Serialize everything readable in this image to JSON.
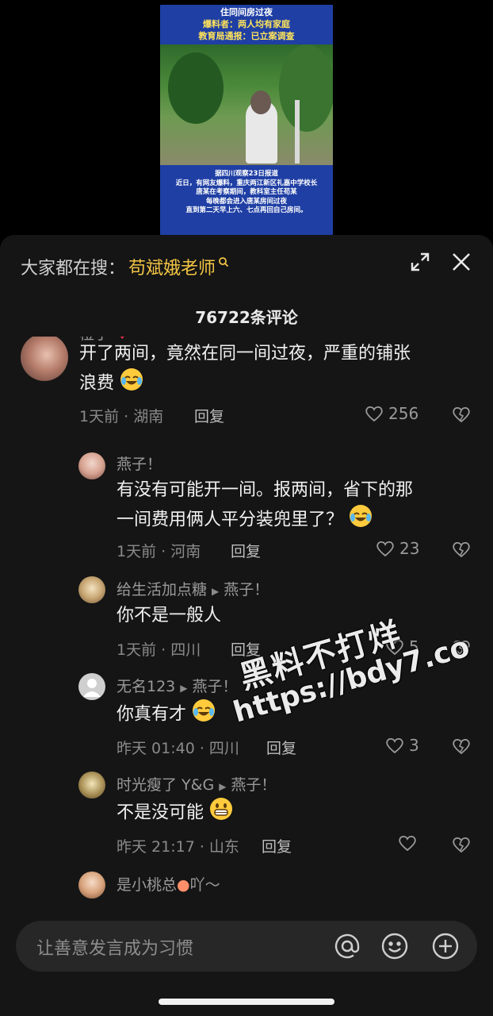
{
  "thumbnail": {
    "top_lines": [
      "住同间房过夜",
      "爆料者：两人均有家庭",
      "教育局通报：已立案调查"
    ],
    "bottom_lines": [
      "据四川观察23日报道",
      "近日，有网友爆料，重庆两江新区礼嘉中学校长",
      "唐某在考察期间，教科室主任苟某",
      "每晚都会进入唐某房间过夜",
      "直到第二天早上六、七点再回自己房间。"
    ]
  },
  "search": {
    "prefix": "大家都在搜：",
    "term": "苟斌娥老师"
  },
  "comment_count": "76722条评论",
  "comments": [
    {
      "user": "橙子",
      "text_line1": "开了两间，竟然在同一间过夜，严重的铺张",
      "text_line2": "浪费",
      "meta": "1天前 · 湖南",
      "reply": "回复",
      "likes": "256"
    },
    {
      "user": "燕子！",
      "text_line1": "有没有可能开一间。报两间，省下的那",
      "text_line2": "一间费用俩人平分装兜里了？",
      "meta": "1天前 · 河南",
      "reply": "回复",
      "likes": "23"
    },
    {
      "user": "给生活加点糖",
      "reply_to": "燕子！",
      "text": "你不是一般人",
      "meta": "1天前 · 四川",
      "reply": "回复",
      "likes": "5"
    },
    {
      "user": "无名123",
      "reply_to": "燕子！",
      "text": "你真有才",
      "meta": "昨天 01:40 · 四川",
      "reply": "回复",
      "likes": "3"
    },
    {
      "user": "时光瘦了 Y&G",
      "reply_to": "燕子！",
      "text": "不是没可能",
      "meta": "昨天 21:17 · 山东",
      "reply": "回复",
      "likes": ""
    },
    {
      "user_prefix": "是小桃总",
      "user_suffix": "吖～"
    }
  ],
  "input": {
    "placeholder": "让善意发言成为习惯"
  },
  "watermark": {
    "line1": "黑料不打烊",
    "line2": "https://bdy7.co"
  },
  "colors": {
    "sheet_bg": "#151515",
    "highlight": "#f3c544",
    "thumb_bg": "#1f3fa4"
  }
}
